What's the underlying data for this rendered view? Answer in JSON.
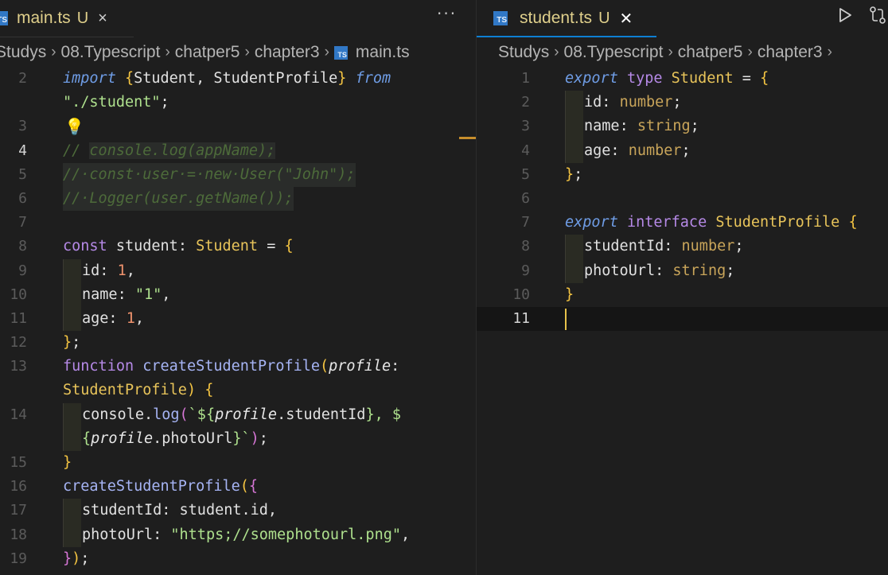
{
  "left": {
    "tab": {
      "name": "main.ts",
      "status": "U",
      "close": "×"
    },
    "more": "···",
    "breadcrumb": [
      "Studys",
      "08.Typescript",
      "chatper5",
      "chapter3",
      "main.ts"
    ],
    "lines": {
      "l2": {
        "num": "2",
        "a": "import",
        "b": "{",
        "c": "Student, StudentProfile",
        "d": "}",
        "e": "from"
      },
      "l2w": {
        "a": "\"./student\"",
        "b": ";"
      },
      "l3": {
        "num": "3"
      },
      "l4": {
        "num": "4",
        "a": "//",
        "b": "console.log(appName);"
      },
      "l5": {
        "num": "5",
        "a": "//·const·user·=·new·User(\"John\");"
      },
      "l6": {
        "num": "6",
        "a": "//·Logger(user.getName());"
      },
      "l7": {
        "num": "7"
      },
      "l8": {
        "num": "8",
        "a": "const",
        "b": "student",
        "c": ":",
        "d": "Student",
        "e": "=",
        "f": "{"
      },
      "l9": {
        "num": "9",
        "a": "id",
        "b": ":",
        "c": "1",
        "d": ","
      },
      "l10": {
        "num": "10",
        "a": "name",
        "b": ":",
        "c": "\"1\"",
        "d": ","
      },
      "l11": {
        "num": "11",
        "a": "age",
        "b": ":",
        "c": "1",
        "d": ","
      },
      "l12": {
        "num": "12",
        "a": "}",
        "b": ";"
      },
      "l13": {
        "num": "13",
        "a": "function",
        "b": "createStudentProfile",
        "c": "(",
        "d": "profile",
        "e": ":"
      },
      "l13w": {
        "a": "StudentProfile",
        "b": ")",
        "c": "{"
      },
      "l14": {
        "num": "14",
        "a": "console",
        "b": ".",
        "c": "log",
        "d": "(",
        "e": "`${",
        "f": "profile",
        "g": ".studentId",
        "h": "}",
        "i": ", $"
      },
      "l14w": {
        "a": "{",
        "b": "profile",
        "c": ".photoUrl",
        "d": "}",
        "e": "`",
        "f": ")",
        "g": ";"
      },
      "l15": {
        "num": "15",
        "a": "}"
      },
      "l16": {
        "num": "16",
        "a": "createStudentProfile",
        "b": "(",
        "c": "{"
      },
      "l17": {
        "num": "17",
        "a": "studentId",
        "b": ":",
        "c": "student.id,"
      },
      "l18": {
        "num": "18",
        "a": "photoUrl",
        "b": ":",
        "c": "\"https;//somephotourl.png\"",
        "d": ","
      },
      "l19": {
        "num": "19",
        "a": "}",
        "b": ")",
        "c": ";"
      }
    }
  },
  "right": {
    "tab": {
      "name": "student.ts",
      "status": "U",
      "close": "✕"
    },
    "breadcrumb": [
      "Studys",
      "08.Typescript",
      "chatper5",
      "chapter3"
    ],
    "lines": {
      "r1": {
        "num": "1",
        "a": "export",
        "b": "type",
        "c": "Student",
        "d": "=",
        "e": "{"
      },
      "r2": {
        "num": "2",
        "a": "id",
        "b": ":",
        "c": "number",
        "d": ";"
      },
      "r3": {
        "num": "3",
        "a": "name",
        "b": ":",
        "c": "string",
        "d": ";"
      },
      "r4": {
        "num": "4",
        "a": "age",
        "b": ":",
        "c": "number",
        "d": ";"
      },
      "r5": {
        "num": "5",
        "a": "}",
        "b": ";"
      },
      "r6": {
        "num": "6"
      },
      "r7": {
        "num": "7",
        "a": "export",
        "b": "interface",
        "c": "StudentProfile",
        "d": "{"
      },
      "r8": {
        "num": "8",
        "a": "studentId",
        "b": ":",
        "c": "number",
        "d": ";"
      },
      "r9": {
        "num": "9",
        "a": "photoUrl",
        "b": ":",
        "c": "string",
        "d": ";"
      },
      "r10": {
        "num": "10",
        "a": "}"
      },
      "r11": {
        "num": "11"
      }
    }
  },
  "icons": {
    "ts_label": "TS",
    "lightbulb": "lightbulb-icon",
    "run": "play-icon",
    "compare": "compare-changes-icon"
  },
  "colors": {
    "accent": "#0e7fd3",
    "modified": "#dfcf8b",
    "ts_icon": "#3178c6"
  }
}
